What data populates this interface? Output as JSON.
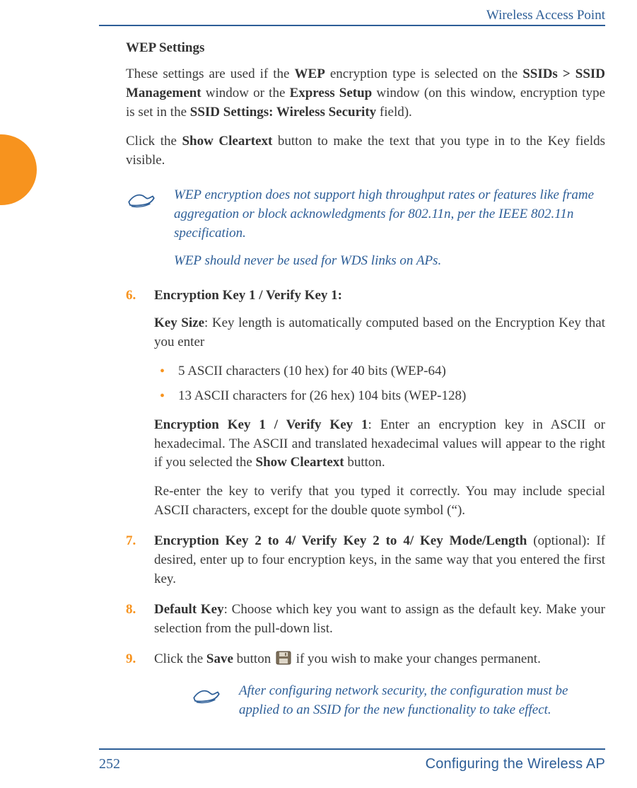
{
  "header": {
    "title": "Wireless Access Point"
  },
  "footer": {
    "page_number": "252",
    "section": "Configuring the Wireless AP"
  },
  "content": {
    "heading": "WEP Settings",
    "p1a": "These settings are used if the ",
    "p1_wep": "WEP",
    "p1b": " encryption type is selected on the ",
    "p1_ssids": "SSIDs > SSID Management",
    "p1c": " window or the ",
    "p1_express": "Express Setup",
    "p1d": " window (on this window, encryption type is set in the ",
    "p1_ssidset": "SSID Settings: Wireless Security",
    "p1e": " field).",
    "p2a": "Click the ",
    "p2_show": "Show Cleartext",
    "p2b": " button to make the text that you type in to the Key fields visible."
  },
  "note1": {
    "line1": "WEP encryption does not support high throughput rates or features like frame aggregation or block acknowledgments for 802.11n, per the IEEE 802.11n specification.",
    "line2": "WEP should never be used for WDS links on APs."
  },
  "items": {
    "i6": {
      "num": "6.",
      "title": "Encryption Key 1 / Verify Key 1:",
      "p1a": "Key Size",
      "p1b": ": Key length is automatically computed based on the Encryption Key that you enter",
      "bul1": "5 ASCII characters (10 hex) for 40 bits (WEP-64)",
      "bul2": "13 ASCII characters for (26 hex) 104 bits (WEP-128)",
      "p2a": "Encryption Key 1 / Verify Key 1",
      "p2b": ": Enter an encryption key in ASCII or hexadecimal. The ASCII and translated hexadecimal values will appear to the right if you selected the ",
      "p2_show": "Show Cleartext",
      "p2c": " button.",
      "p3": "Re-enter the key to verify that you typed it correctly. You may include special ASCII characters, except for the double quote symbol (“)."
    },
    "i7": {
      "num": "7.",
      "title": "Encryption Key 2 to 4/ Verify Key 2 to 4/ Key Mode/Length",
      "rest": " (optional): If desired, enter up to four encryption keys, in the same way that you entered the first key."
    },
    "i8": {
      "num": "8.",
      "title": "Default Key",
      "rest": ": Choose which key you want to assign as the default key. Make your selection from the pull-down list."
    },
    "i9": {
      "num": "9.",
      "a": "Click the ",
      "save": "Save",
      "b": " button ",
      "c": " if you wish to make your changes permanent."
    }
  },
  "note2": {
    "text": "After configuring network security, the configuration must be applied to an SSID for the new functionality to take effect."
  }
}
